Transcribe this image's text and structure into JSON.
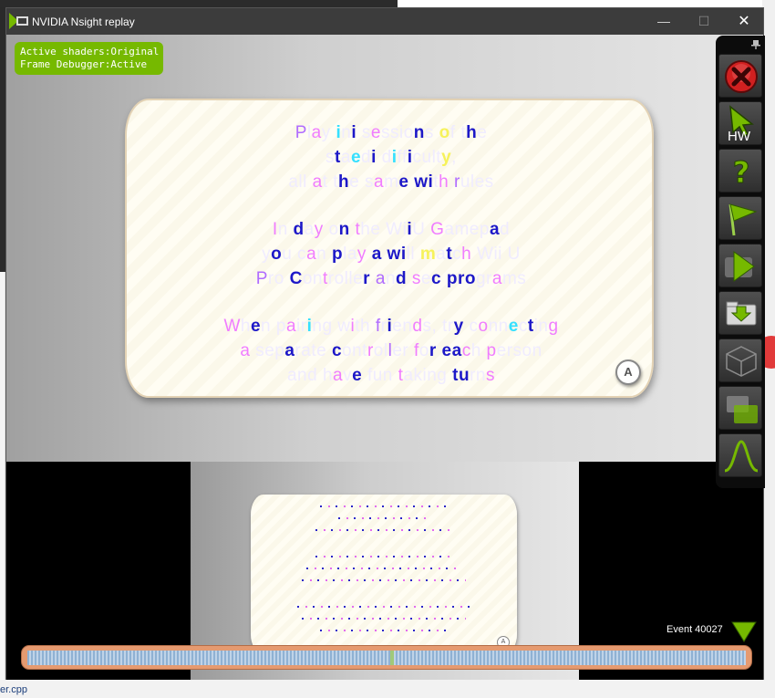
{
  "window": {
    "title": "NVIDIA Nsight replay",
    "controls": {
      "minimize": "—",
      "maximize": "☐",
      "close": "✕"
    }
  },
  "status": {
    "line1": "Active shaders:Original",
    "line2": "Frame Debugger:Active"
  },
  "card": {
    "button_label": "A"
  },
  "mini_card": {
    "button_label": "A"
  },
  "toolbar": {
    "pin_icon": "pin-icon",
    "buttons": [
      {
        "name": "stop-button",
        "icon": "red-x-icon"
      },
      {
        "name": "hw-cursor-button",
        "icon": "cursor-icon",
        "label": "HW"
      },
      {
        "name": "help-button",
        "icon": "question-icon"
      },
      {
        "name": "flag-button",
        "icon": "green-flag-icon"
      },
      {
        "name": "play-button",
        "icon": "play-icon"
      },
      {
        "name": "capture-button",
        "icon": "download-folder-icon"
      },
      {
        "name": "wireframe-button",
        "icon": "cube-icon"
      },
      {
        "name": "overlay-button",
        "icon": "windows-icon"
      },
      {
        "name": "graph-button",
        "icon": "curve-icon"
      }
    ]
  },
  "event": {
    "label": "Event 40027"
  },
  "background": {
    "file_text": "er.cpp"
  },
  "colors": {
    "nvidia_green": "#76b900",
    "timeline": "#e59a70"
  }
}
